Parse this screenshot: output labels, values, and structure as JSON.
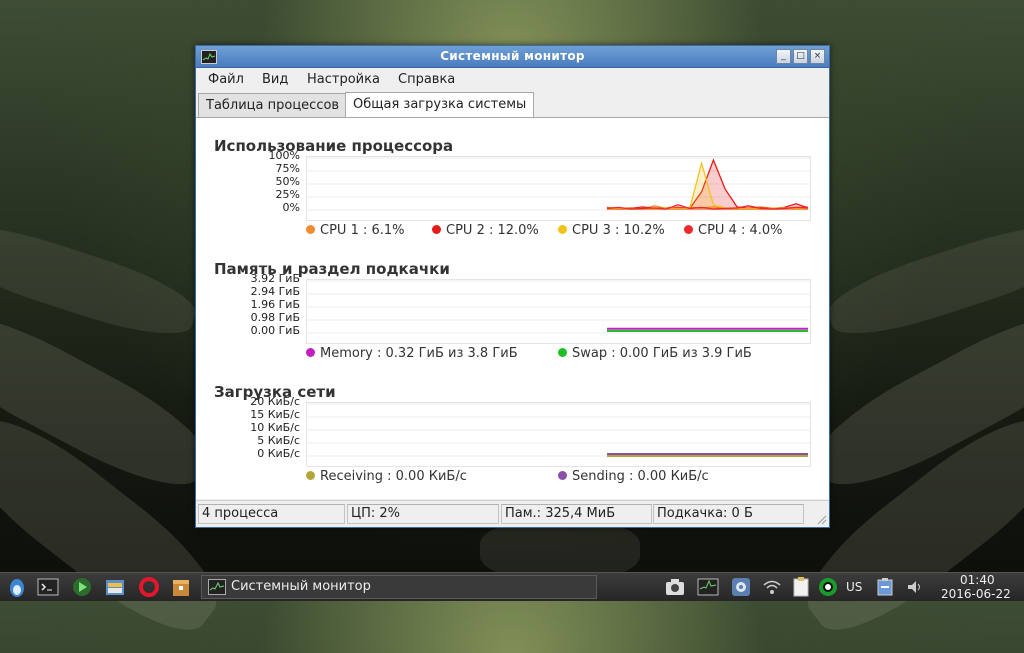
{
  "window": {
    "title": "Системный монитор",
    "controls": {
      "minimize": "_",
      "maximize": "□",
      "close": "×"
    }
  },
  "menu": [
    "Файл",
    "Вид",
    "Настройка",
    "Справка"
  ],
  "tabs": [
    {
      "label": "Таблица процессов",
      "active": false
    },
    {
      "label": "Общая загрузка системы",
      "active": true
    }
  ],
  "cpu": {
    "title": "Использование процессора",
    "y_ticks": [
      "100%",
      "75%",
      "50%",
      "25%",
      "0%"
    ],
    "legend": [
      {
        "label": "CPU 1 : 6.1%",
        "color": "#f28a30"
      },
      {
        "label": "CPU 2 : 12.0%",
        "color": "#e51b1b"
      },
      {
        "label": "CPU 3 : 10.2%",
        "color": "#f5c21b"
      },
      {
        "label": "CPU 4 : 4.0%",
        "color": "#ef2929"
      }
    ]
  },
  "memory": {
    "title": "Память и раздел подкачки",
    "y_ticks": [
      "3.92 ГиБ",
      "2.94 ГиБ",
      "1.96 ГиБ",
      "0.98 ГиБ",
      "0.00 ГиБ"
    ],
    "legend": [
      {
        "label": "Memory : 0.32 ГиБ из 3.8 ГиБ",
        "color": "#c21fc2"
      },
      {
        "label": "Swap : 0.00 ГиБ из 3.9 ГиБ",
        "color": "#1fbf2a"
      }
    ]
  },
  "network": {
    "title": "Загрузка сети",
    "y_ticks": [
      "20 КиБ/с",
      "15 КиБ/с",
      "10 КиБ/с",
      "5 КиБ/с",
      "0 КиБ/с"
    ],
    "legend": [
      {
        "label": "Receiving : 0.00 КиБ/с",
        "color": "#b3a638"
      },
      {
        "label": "Sending : 0.00 КиБ/с",
        "color": "#8a4fad"
      }
    ]
  },
  "status": {
    "processes": "4 процесса",
    "cpu": "ЦП: 2%",
    "memory": "Пам.: 325,4 МиБ",
    "swap": "Подкачка: 0 Б"
  },
  "taskbar": {
    "task_label": "Системный монитор",
    "keyboard_layout": "US",
    "time": "01:40",
    "date": "2016-06-22"
  },
  "chart_data": [
    {
      "type": "line",
      "title": "Использование процессора",
      "ylabel": "",
      "ylim": [
        0,
        100
      ],
      "series": [
        {
          "name": "CPU 1 : 6.1%",
          "values": [
            5,
            3,
            4,
            2,
            8,
            3,
            3,
            5,
            4,
            6,
            3,
            2,
            4,
            6,
            3,
            3,
            5,
            6
          ]
        },
        {
          "name": "CPU 2 : 12.0%",
          "values": [
            4,
            2,
            3,
            6,
            3,
            4,
            5,
            3,
            35,
            96,
            40,
            6,
            3,
            4,
            3,
            5,
            12,
            4
          ]
        },
        {
          "name": "CPU 3 : 10.2%",
          "values": [
            2,
            3,
            2,
            3,
            2,
            4,
            3,
            3,
            90,
            10,
            4,
            2,
            3,
            2,
            3,
            4,
            2,
            3
          ]
        },
        {
          "name": "CPU 4 : 4.0%",
          "values": [
            3,
            5,
            2,
            3,
            4,
            2,
            10,
            3,
            5,
            2,
            3,
            4,
            8,
            3,
            2,
            3,
            5,
            4
          ]
        }
      ]
    },
    {
      "type": "line",
      "title": "Память и раздел подкачки",
      "ylabel": "",
      "ylim": [
        0,
        3.92
      ],
      "series": [
        {
          "name": "Memory : 0.32 ГиБ из 3.8 ГиБ",
          "values": [
            0.32,
            0.32,
            0.32,
            0.32
          ]
        },
        {
          "name": "Swap : 0.00 ГиБ из 3.9 ГиБ",
          "values": [
            0.0,
            0.0,
            0.0,
            0.0
          ]
        }
      ]
    },
    {
      "type": "line",
      "title": "Загрузка сети",
      "ylabel": "",
      "ylim": [
        0,
        20
      ],
      "series": [
        {
          "name": "Receiving : 0.00 КиБ/с",
          "values": [
            0,
            0,
            0,
            0
          ]
        },
        {
          "name": "Sending : 0.00 КиБ/с",
          "values": [
            0,
            0,
            0,
            0
          ]
        }
      ]
    }
  ]
}
